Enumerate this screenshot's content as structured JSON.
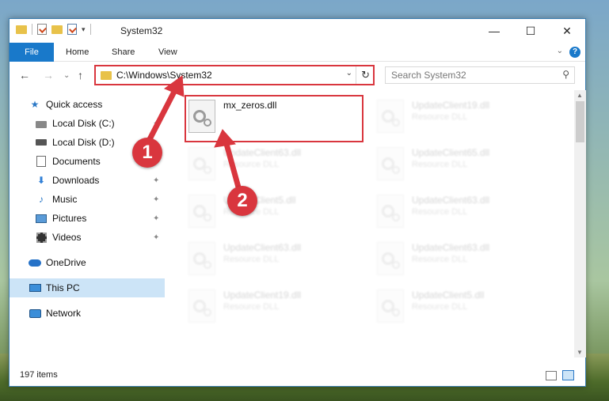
{
  "window": {
    "title": "System32",
    "minimize_glyph": "—",
    "maximize_glyph": "☐",
    "close_glyph": "✕"
  },
  "ribbon": {
    "tabs": [
      "File",
      "Home",
      "Share",
      "View"
    ],
    "help_glyph": "?"
  },
  "navigation": {
    "back_glyph": "←",
    "forward_glyph": "→",
    "up_glyph": "↑",
    "address": "C:\\Windows\\System32",
    "search_placeholder": "Search System32"
  },
  "sidebar": {
    "items": [
      {
        "label": "Quick access",
        "icon": "star-icon"
      },
      {
        "label": "Local Disk (C:)",
        "icon": "disk-icon"
      },
      {
        "label": "Local Disk (D:)",
        "icon": "disk-icon"
      },
      {
        "label": "Documents",
        "icon": "document-icon"
      },
      {
        "label": "Downloads",
        "icon": "download-icon"
      },
      {
        "label": "Music",
        "icon": "music-icon"
      },
      {
        "label": "Pictures",
        "icon": "picture-icon"
      },
      {
        "label": "Videos",
        "icon": "video-icon"
      },
      {
        "label": "OneDrive",
        "icon": "cloud-icon"
      },
      {
        "label": "This PC",
        "icon": "computer-icon"
      },
      {
        "label": "Network",
        "icon": "network-icon"
      }
    ],
    "pin_glyph": "📌",
    "pin_glyph_alt": "✦"
  },
  "files": [
    {
      "name": "mx_zeros.dll",
      "type": ""
    },
    {
      "name": "UpdateClient19.dll",
      "type": "Resource DLL"
    },
    {
      "name": "UpdateClient63.dll",
      "type": "Resource DLL"
    },
    {
      "name": "UpdateClient65.dll",
      "type": "Resource DLL"
    },
    {
      "name": "UpdateClient5.dll",
      "type": "Resource DLL"
    },
    {
      "name": "UpdateClient63.dll",
      "type": "Resource DLL"
    },
    {
      "name": "UpdateClient63.dll",
      "type": "Resource DLL"
    },
    {
      "name": "UpdateClient63.dll",
      "type": "Resource DLL"
    },
    {
      "name": "UpdateClient19.dll",
      "type": "Resource DLL"
    },
    {
      "name": "UpdateClient5.dll",
      "type": "Resource DLL"
    }
  ],
  "status": {
    "item_count": "197 items"
  },
  "annotations": {
    "step1": "1",
    "step2": "2",
    "color": "#d9363e"
  }
}
